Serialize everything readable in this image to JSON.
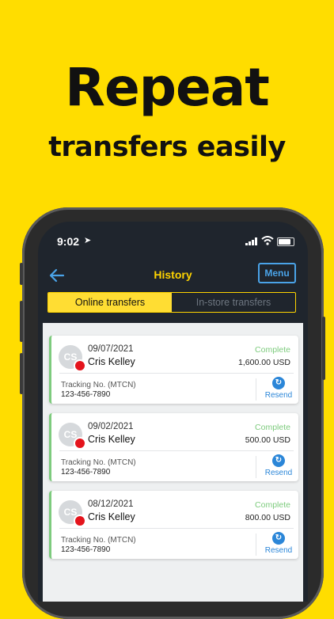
{
  "promo": {
    "headline": "Repeat",
    "subheadline": "transfers easily"
  },
  "status_bar": {
    "time": "9:02",
    "location_glyph": "➤"
  },
  "app_bar": {
    "back_glyph": "←",
    "title": "History",
    "menu_label": "Menu"
  },
  "tabs": [
    {
      "label": "Online transfers",
      "active": true
    },
    {
      "label": "In-store transfers",
      "active": false
    }
  ],
  "transfers": [
    {
      "initials": "CS",
      "date": "09/07/2021",
      "name": "Cris Kelley",
      "status": "Complete",
      "amount": "1,600.00 USD",
      "tracking_label": "Tracking No. (MTCN)",
      "tracking_number": "123-456-7890",
      "resend_label": "Resend"
    },
    {
      "initials": "CS",
      "date": "09/02/2021",
      "name": "Cris Kelley",
      "status": "Complete",
      "amount": "500.00 USD",
      "tracking_label": "Tracking No. (MTCN)",
      "tracking_number": "123-456-7890",
      "resend_label": "Resend"
    },
    {
      "initials": "CS",
      "date": "08/12/2021",
      "name": "Cris Kelley",
      "status": "Complete",
      "amount": "800.00 USD",
      "tracking_label": "Tracking No. (MTCN)",
      "tracking_number": "123-456-7890",
      "resend_label": "Resend"
    }
  ],
  "icons": {
    "resend": "refresh-icon",
    "back": "back-arrow-icon"
  },
  "colors": {
    "background": "#FFDD00",
    "accent": "#FFD400",
    "link": "#2b86d8",
    "success": "#7dcb7d",
    "dot": "#e4141c"
  }
}
